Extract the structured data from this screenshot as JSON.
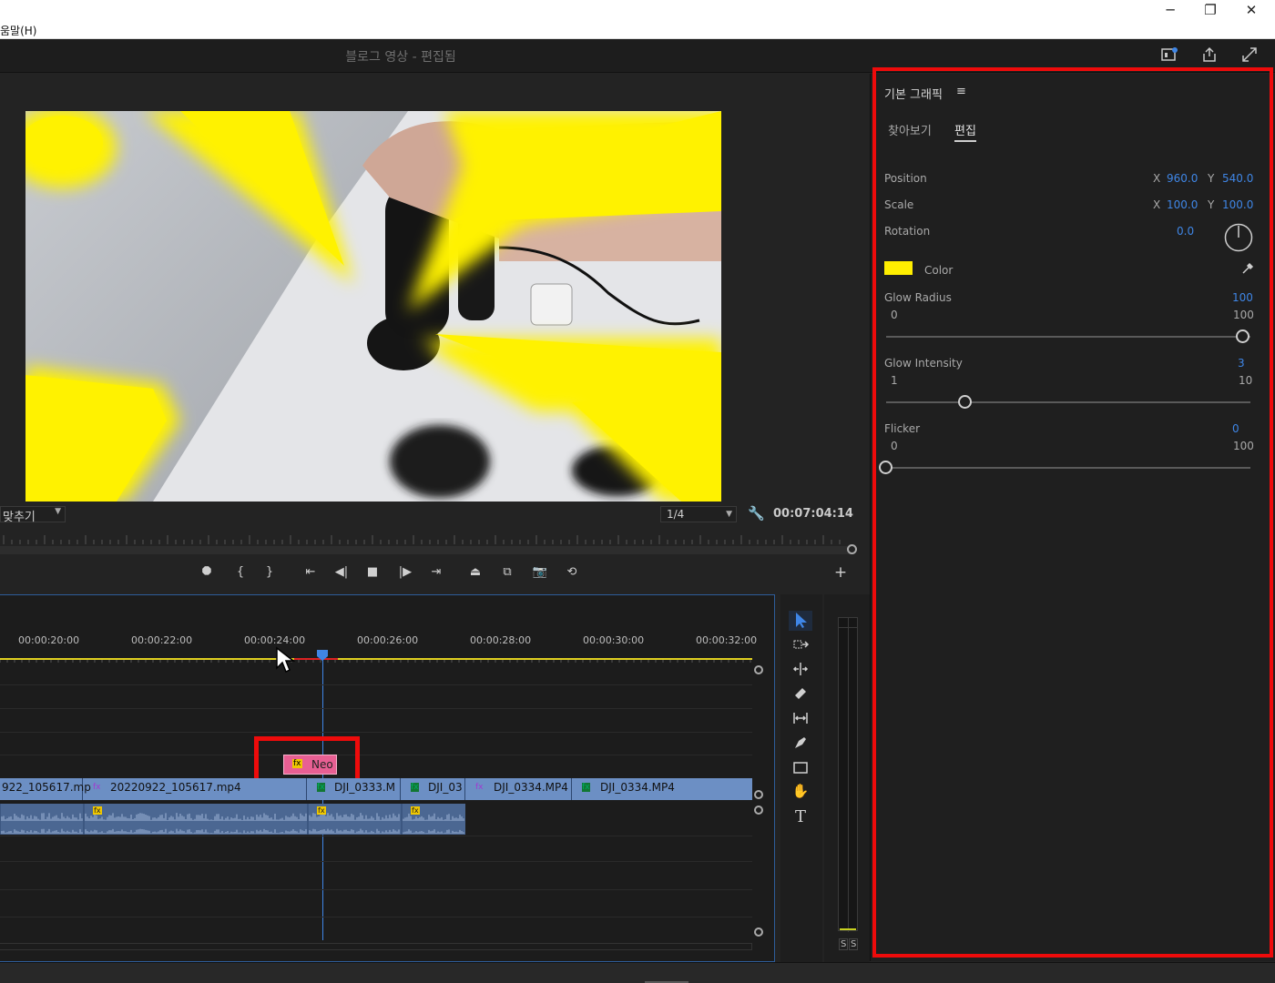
{
  "window": {
    "min": "─",
    "restore": "❐",
    "close": "✕"
  },
  "menu": {
    "help": "움말(H)"
  },
  "header": {
    "title": "블로그 영상 - 편집됨"
  },
  "monitor": {
    "fit_label": "맞추기",
    "resolution": "1/4",
    "timecode": "00:07:04:14"
  },
  "transport": {
    "buttons": [
      "marker",
      "mark-in",
      "mark-out",
      "go-to-in",
      "step-back",
      "stop",
      "step-forward",
      "go-to-out",
      "lift",
      "extract",
      "export-frame",
      "comparison"
    ],
    "add": "+"
  },
  "timeline": {
    "ticks": [
      "00:00:20:00",
      "00:00:22:00",
      "00:00:24:00",
      "00:00:26:00",
      "00:00:28:00",
      "00:00:30:00",
      "00:00:32:00"
    ],
    "graphic_clip": "Neo",
    "video_clips": [
      "922_105617.mp",
      "20220922_105617.mp4",
      "DJI_0333.M",
      "DJI_03",
      "DJI_0334.MP4",
      "DJI_0334.MP4"
    ],
    "fx_badge": "fx"
  },
  "meter": {
    "solo_left": "S",
    "solo_right": "S"
  },
  "panel": {
    "title": "기본 그래픽",
    "menu_icon": "≡",
    "tabs": [
      "찾아보기",
      "편집"
    ],
    "position": {
      "label": "Position",
      "x_label": "X",
      "x": "960.0",
      "y_label": "Y",
      "y": "540.0"
    },
    "scale": {
      "label": "Scale",
      "x_label": "X",
      "x": "100.0",
      "y_label": "Y",
      "y": "100.0"
    },
    "rotation": {
      "label": "Rotation",
      "value": "0.0"
    },
    "color": {
      "label": "Color",
      "swatch": "#ffee00"
    },
    "glow_radius": {
      "label": "Glow Radius",
      "value": "100",
      "min": "0",
      "max": "100",
      "level": 1.0
    },
    "glow_intensity": {
      "label": "Glow Intensity",
      "value": "3",
      "min": "1",
      "max": "10",
      "level": 0.222
    },
    "flicker": {
      "label": "Flicker",
      "value": "0",
      "min": "0",
      "max": "100",
      "level": 0.0
    }
  },
  "colors": {
    "accent": "#3f86e6",
    "highlight": "#ee0b0b",
    "clip_video": "#6c8fc4",
    "clip_graphic": "#e85f93"
  }
}
